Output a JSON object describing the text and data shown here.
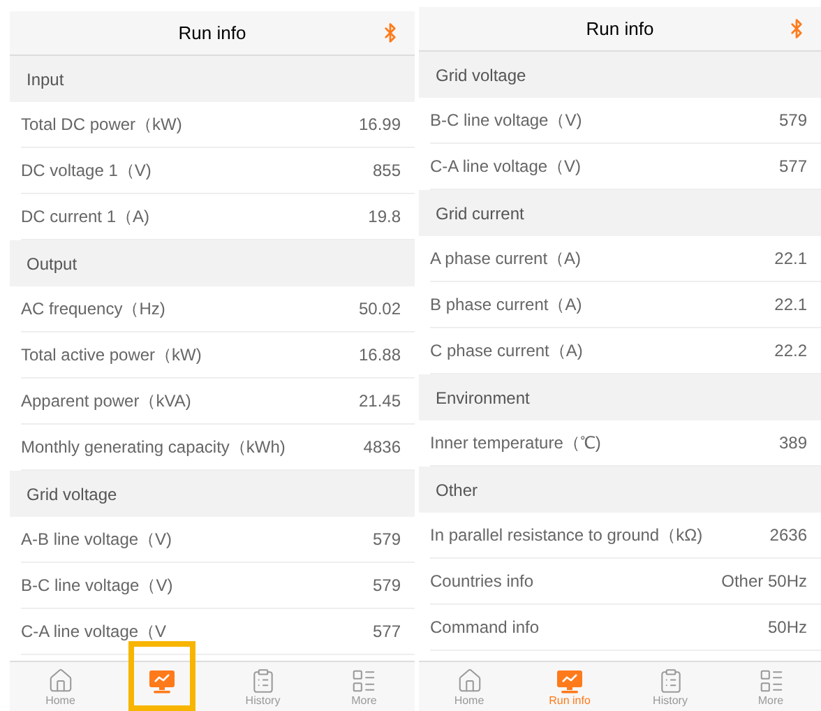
{
  "screens": [
    {
      "title": "Run info",
      "sections": [
        {
          "title": "Input",
          "rows": [
            {
              "label": "Total DC power（kW)",
              "value": "16.99"
            },
            {
              "label": "DC voltage 1（V)",
              "value": "855"
            },
            {
              "label": "DC current 1（A)",
              "value": "19.8"
            }
          ]
        },
        {
          "title": "Output",
          "rows": [
            {
              "label": "AC frequency（Hz)",
              "value": "50.02"
            },
            {
              "label": "Total active power（kW)",
              "value": "16.88"
            },
            {
              "label": "Apparent power（kVA)",
              "value": "21.45"
            },
            {
              "label": "Monthly generating capacity（kWh)",
              "value": "4836"
            }
          ]
        },
        {
          "title": "Grid voltage",
          "rows": [
            {
              "label": "A-B line voltage（V)",
              "value": "579"
            },
            {
              "label": "B-C line voltage（V)",
              "value": "579"
            },
            {
              "label": "C-A line voltage（V",
              "value": "577"
            }
          ]
        }
      ],
      "tabs": [
        {
          "kind": "home",
          "label": "Home",
          "selected": false,
          "highlighted": false
        },
        {
          "kind": "run",
          "selected": true,
          "highlighted": true
        },
        {
          "kind": "history",
          "label": "History",
          "selected": false,
          "highlighted": false
        },
        {
          "kind": "more",
          "label": "More",
          "selected": false,
          "highlighted": false
        }
      ]
    },
    {
      "title": "Run info",
      "sections": [
        {
          "title": "Grid voltage",
          "rows": [
            {
              "label": "B-C line voltage（V)",
              "value": "579"
            },
            {
              "label": "C-A line voltage（V)",
              "value": "577"
            }
          ]
        },
        {
          "title": "Grid current",
          "rows": [
            {
              "label": "A phase current（A)",
              "value": "22.1"
            },
            {
              "label": "B phase current（A)",
              "value": "22.1"
            },
            {
              "label": "C phase current（A)",
              "value": "22.2"
            }
          ]
        },
        {
          "title": "Environment",
          "rows": [
            {
              "label": "Inner temperature（℃)",
              "value": "389"
            }
          ]
        },
        {
          "title": "Other",
          "rows": [
            {
              "label": "In parallel resistance to ground（kΩ)",
              "value": "2636"
            },
            {
              "label": "Countries info",
              "value": "Other 50Hz"
            },
            {
              "label": "Command info",
              "value": "50Hz"
            }
          ]
        }
      ],
      "tabs": [
        {
          "kind": "home",
          "label": "Home",
          "selected": false,
          "highlighted": false
        },
        {
          "kind": "run",
          "label": "Run info",
          "selected": true,
          "highlighted": false
        },
        {
          "kind": "history",
          "label": "History",
          "selected": false,
          "highlighted": false
        },
        {
          "kind": "more",
          "label": "More",
          "selected": false,
          "highlighted": false
        }
      ]
    }
  ]
}
